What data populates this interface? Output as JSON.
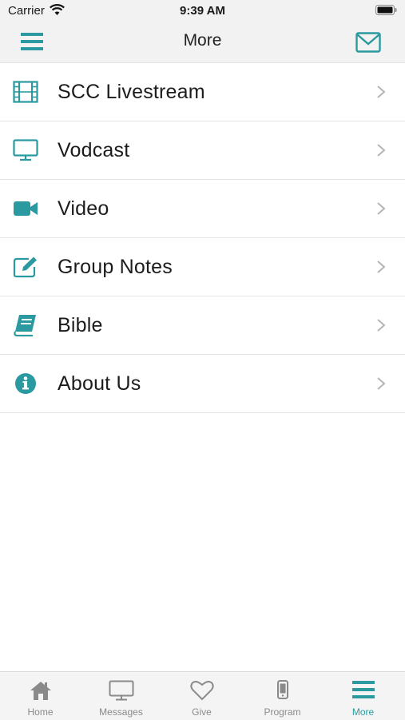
{
  "status_bar": {
    "carrier": "Carrier",
    "time": "9:39 AM"
  },
  "nav": {
    "title": "More"
  },
  "colors": {
    "accent": "#2a9aa0",
    "chevron": "#b5b5b5",
    "inactive_tab": "#8a8a8a"
  },
  "menu": {
    "items": [
      {
        "label": "SCC Livestream",
        "icon": "film-icon"
      },
      {
        "label": "Vodcast",
        "icon": "monitor-icon"
      },
      {
        "label": "Video",
        "icon": "video-camera-icon"
      },
      {
        "label": "Group Notes",
        "icon": "edit-note-icon"
      },
      {
        "label": "Bible",
        "icon": "book-icon"
      },
      {
        "label": "About Us",
        "icon": "info-icon"
      }
    ]
  },
  "tabs": [
    {
      "label": "Home",
      "icon": "home-icon",
      "active": false
    },
    {
      "label": "Messages",
      "icon": "monitor-icon",
      "active": false
    },
    {
      "label": "Give",
      "icon": "heart-icon",
      "active": false
    },
    {
      "label": "Program",
      "icon": "phone-icon",
      "active": false
    },
    {
      "label": "More",
      "icon": "hamburger-icon",
      "active": true
    }
  ]
}
